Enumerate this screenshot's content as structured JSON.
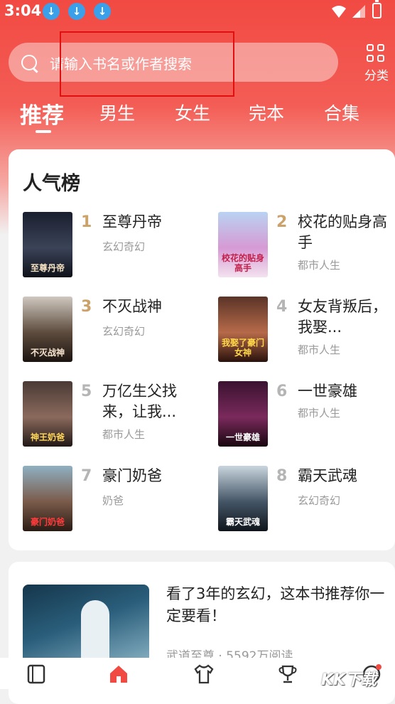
{
  "status_bar": {
    "time": "3:04",
    "download_icon": "↓"
  },
  "search": {
    "placeholder": "请输入书名或作者搜索"
  },
  "category": {
    "label": "分类"
  },
  "tabs": [
    {
      "label": "推荐",
      "active": true
    },
    {
      "label": "男生",
      "active": false
    },
    {
      "label": "女生",
      "active": false
    },
    {
      "label": "完本",
      "active": false
    },
    {
      "label": "合集",
      "active": false
    }
  ],
  "popular": {
    "title": "人气榜",
    "books": [
      {
        "rank": "1",
        "title": "至尊丹帝",
        "genre": "玄幻奇幻",
        "cover_text": "至尊丹帝"
      },
      {
        "rank": "2",
        "title": "校花的贴身高手",
        "genre": "都市人生",
        "cover_text": "校花的贴身高手"
      },
      {
        "rank": "3",
        "title": "不灭战神",
        "genre": "玄幻奇幻",
        "cover_text": "不灭战神"
      },
      {
        "rank": "4",
        "title": "女友背叛后，我娶...",
        "genre": "都市人生",
        "cover_text": "我娶了豪门女神"
      },
      {
        "rank": "5",
        "title": "万亿生父找来，让我...",
        "genre": "都市人生",
        "cover_text": "神王奶爸"
      },
      {
        "rank": "6",
        "title": "一世豪雄",
        "genre": "都市人生",
        "cover_text": "一世豪雄"
      },
      {
        "rank": "7",
        "title": "豪门奶爸",
        "genre": "奶爸",
        "cover_text": "豪门奶爸"
      },
      {
        "rank": "8",
        "title": "霸天武魂",
        "genre": "玄幻奇幻",
        "cover_text": "霸天武魂"
      }
    ]
  },
  "recommend": {
    "title": "看了3年的玄幻，这本书推荐你一定要看！",
    "meta": "武道至尊 · 5592万阅读"
  },
  "watermark": "KK下载",
  "colors": {
    "brand_red": "#f14a43",
    "rank_gold": "#caa26a",
    "rank_gray": "#b5b5b5",
    "download_blue": "#3aa0ea"
  }
}
